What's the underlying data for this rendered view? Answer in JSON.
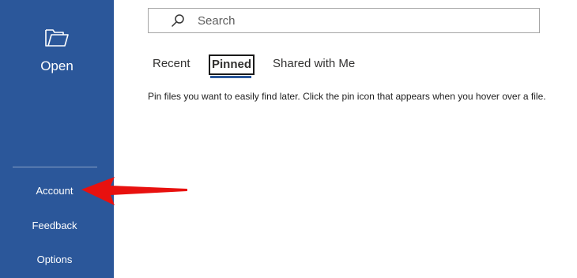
{
  "sidebar": {
    "open_label": "Open",
    "items": [
      {
        "label": "Account"
      },
      {
        "label": "Feedback"
      },
      {
        "label": "Options"
      }
    ],
    "background": "#2b579a"
  },
  "search": {
    "placeholder": "Search"
  },
  "tabs": [
    {
      "label": "Recent",
      "selected": false
    },
    {
      "label": "Pinned",
      "selected": true
    },
    {
      "label": "Shared with Me",
      "selected": false
    }
  ],
  "pinned": {
    "message": "Pin files you want to easily find later. Click the pin icon that appears when you hover over a file."
  },
  "annotation": {
    "arrow_color": "#e8110f",
    "points_to": "Account"
  },
  "icons": {
    "open": "folder-open-icon",
    "search": "search-icon",
    "annotation": "red-arrow-icon"
  }
}
